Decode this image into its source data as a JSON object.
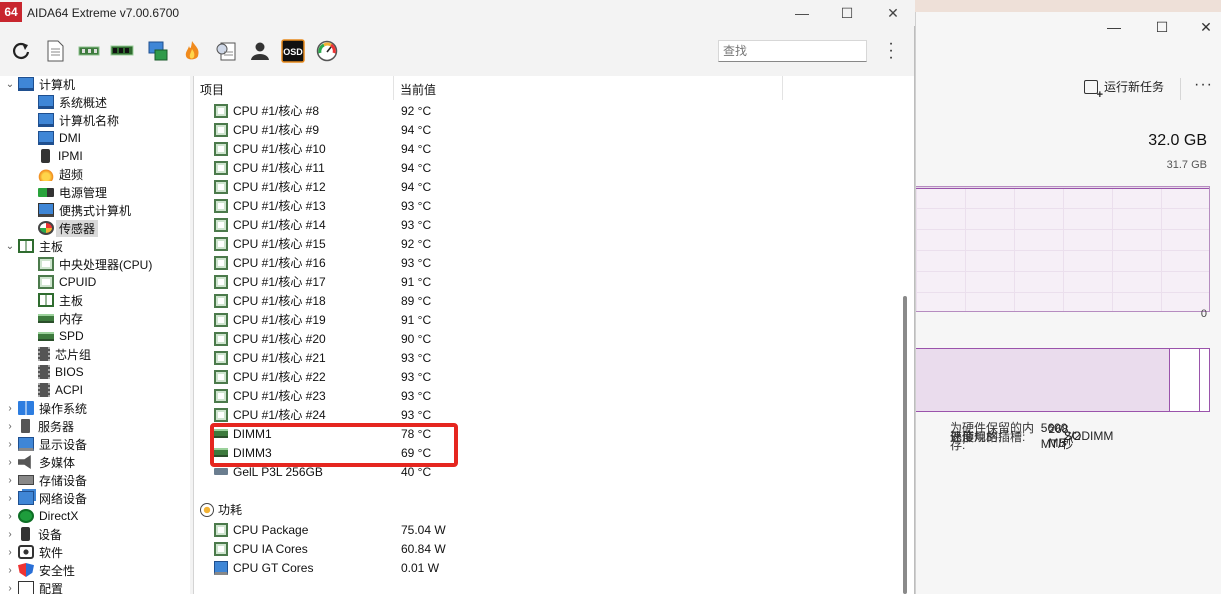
{
  "aida": {
    "title": "AIDA64 Extreme v7.00.6700",
    "logo": "64",
    "search_placeholder": "查找",
    "window_controls": {
      "minimize": "—",
      "maximize": "☐",
      "close": "✕"
    },
    "toolbar_icons": [
      "refresh-icon",
      "report-icon",
      "motherboard-icon",
      "memory-icon",
      "network-icon",
      "flame-icon",
      "benchmark-icon",
      "user-icon",
      "osd-icon",
      "gauge-icon"
    ],
    "osd_label": "OSD"
  },
  "tree": [
    {
      "label": "计算机",
      "icon": "computer-icon",
      "level": 0,
      "expander": "open"
    },
    {
      "label": "系统概述",
      "icon": "monitor-icon",
      "level": 1
    },
    {
      "label": "计算机名称",
      "icon": "monitor-icon",
      "level": 1
    },
    {
      "label": "DMI",
      "icon": "monitor-icon",
      "level": 1
    },
    {
      "label": "IPMI",
      "icon": "device-icon",
      "level": 1
    },
    {
      "label": "超频",
      "icon": "flame-icon",
      "level": 1
    },
    {
      "label": "电源管理",
      "icon": "battery-icon",
      "level": 1
    },
    {
      "label": "便携式计算机",
      "icon": "laptop-icon",
      "level": 1
    },
    {
      "label": "传感器",
      "icon": "gauge-icon",
      "level": 1,
      "selected": true
    },
    {
      "label": "主板",
      "icon": "motherboard-icon",
      "level": 0,
      "expander": "open"
    },
    {
      "label": "中央处理器(CPU)",
      "icon": "cpu-icon",
      "level": 1
    },
    {
      "label": "CPUID",
      "icon": "cpu-icon",
      "level": 1
    },
    {
      "label": "主板",
      "icon": "motherboard-icon",
      "level": 1
    },
    {
      "label": "内存",
      "icon": "memory-icon",
      "level": 1
    },
    {
      "label": "SPD",
      "icon": "memory-icon",
      "level": 1
    },
    {
      "label": "芯片组",
      "icon": "chip-icon",
      "level": 1
    },
    {
      "label": "BIOS",
      "icon": "chip-icon",
      "level": 1
    },
    {
      "label": "ACPI",
      "icon": "chip-icon",
      "level": 1
    },
    {
      "label": "操作系统",
      "icon": "windows-icon",
      "level": 0,
      "expander": "closed"
    },
    {
      "label": "服务器",
      "icon": "server-icon",
      "level": 0,
      "expander": "closed"
    },
    {
      "label": "显示设备",
      "icon": "display-icon",
      "level": 0,
      "expander": "closed"
    },
    {
      "label": "多媒体",
      "icon": "speaker-icon",
      "level": 0,
      "expander": "closed"
    },
    {
      "label": "存储设备",
      "icon": "storage-icon",
      "level": 0,
      "expander": "closed"
    },
    {
      "label": "网络设备",
      "icon": "network-icon",
      "level": 0,
      "expander": "closed"
    },
    {
      "label": "DirectX",
      "icon": "xbox-icon",
      "level": 0,
      "expander": "closed"
    },
    {
      "label": "设备",
      "icon": "device-icon",
      "level": 0,
      "expander": "closed"
    },
    {
      "label": "软件",
      "icon": "software-icon",
      "level": 0,
      "expander": "closed"
    },
    {
      "label": "安全性",
      "icon": "shield-icon",
      "level": 0,
      "expander": "closed"
    },
    {
      "label": "配置",
      "icon": "config-icon",
      "level": 0,
      "expander": "closed"
    }
  ],
  "table": {
    "col_item": "项目",
    "col_value": "当前值",
    "rows": [
      {
        "name": "CPU #1/核心 #8",
        "value": "92 °C",
        "icon": "cpu-icon"
      },
      {
        "name": "CPU #1/核心 #9",
        "value": "94 °C",
        "icon": "cpu-icon"
      },
      {
        "name": "CPU #1/核心 #10",
        "value": "94 °C",
        "icon": "cpu-icon"
      },
      {
        "name": "CPU #1/核心 #11",
        "value": "94 °C",
        "icon": "cpu-icon"
      },
      {
        "name": "CPU #1/核心 #12",
        "value": "94 °C",
        "icon": "cpu-icon"
      },
      {
        "name": "CPU #1/核心 #13",
        "value": "93 °C",
        "icon": "cpu-icon"
      },
      {
        "name": "CPU #1/核心 #14",
        "value": "93 °C",
        "icon": "cpu-icon"
      },
      {
        "name": "CPU #1/核心 #15",
        "value": "92 °C",
        "icon": "cpu-icon"
      },
      {
        "name": "CPU #1/核心 #16",
        "value": "93 °C",
        "icon": "cpu-icon"
      },
      {
        "name": "CPU #1/核心 #17",
        "value": "91 °C",
        "icon": "cpu-icon"
      },
      {
        "name": "CPU #1/核心 #18",
        "value": "89 °C",
        "icon": "cpu-icon"
      },
      {
        "name": "CPU #1/核心 #19",
        "value": "91 °C",
        "icon": "cpu-icon"
      },
      {
        "name": "CPU #1/核心 #20",
        "value": "90 °C",
        "icon": "cpu-icon"
      },
      {
        "name": "CPU #1/核心 #21",
        "value": "93 °C",
        "icon": "cpu-icon"
      },
      {
        "name": "CPU #1/核心 #22",
        "value": "93 °C",
        "icon": "cpu-icon"
      },
      {
        "name": "CPU #1/核心 #23",
        "value": "93 °C",
        "icon": "cpu-icon"
      },
      {
        "name": "CPU #1/核心 #24",
        "value": "93 °C",
        "icon": "cpu-icon"
      },
      {
        "name": "DIMM1",
        "value": "78 °C",
        "icon": "memory-icon"
      },
      {
        "name": "DIMM3",
        "value": "69 °C",
        "icon": "memory-icon"
      },
      {
        "name": "GelL P3L 256GB",
        "value": "40 °C",
        "icon": "ssd-icon"
      }
    ],
    "power_section": "功耗",
    "power_rows": [
      {
        "name": "CPU Package",
        "value": "75.04 W",
        "icon": "cpu-icon"
      },
      {
        "name": "CPU IA Cores",
        "value": "60.84 W",
        "icon": "cpu-icon"
      },
      {
        "name": "CPU GT Cores",
        "value": "0.01 W",
        "icon": "display-icon"
      }
    ]
  },
  "taskmgr": {
    "run_task": "运行新任务",
    "more": "···",
    "total": "32.0 GB",
    "used_top": "31.7 GB",
    "zero": "0",
    "usage_fraction": 0.99,
    "stats": [
      {
        "k": "速度:",
        "v": "5600 MT/秒"
      },
      {
        "k": "已使用的插槽:",
        "v": "2/2"
      },
      {
        "k": "外形规格:",
        "v": "SODIMM"
      },
      {
        "k": "为硬件保留的内存:",
        "v": "268 MB"
      }
    ]
  },
  "colors": {
    "highlight_box": "#e5261f",
    "accent": "#9a53ab"
  }
}
